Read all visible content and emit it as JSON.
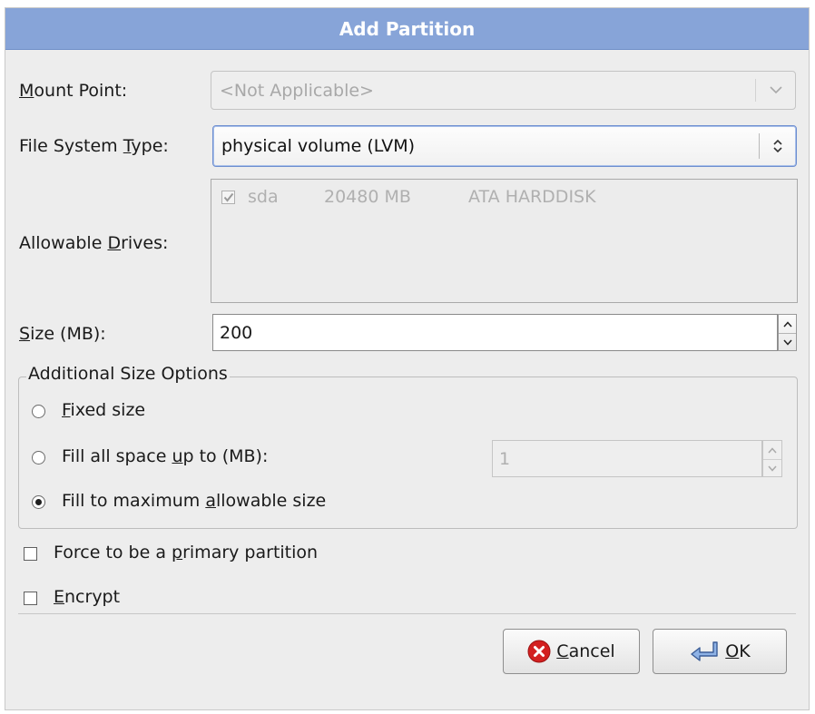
{
  "dialog": {
    "title": "Add Partition"
  },
  "mount_point": {
    "label_prefix": "",
    "label_mnemonic": "M",
    "label_rest": "ount Point:",
    "value": "<Not Applicable>"
  },
  "fs_type": {
    "label_prefix": "File System ",
    "label_mnemonic": "T",
    "label_rest": "ype:",
    "value": "physical volume (LVM)"
  },
  "drives": {
    "label_prefix": "Allowable ",
    "label_mnemonic": "D",
    "label_rest": "rives:",
    "items": [
      {
        "checked": true,
        "name": "sda",
        "size": "20480 MB",
        "model": "ATA HARDDISK"
      }
    ]
  },
  "size": {
    "label_prefix": "",
    "label_mnemonic": "S",
    "label_rest": "ize (MB):",
    "value": "200"
  },
  "size_options": {
    "title": "Additional Size Options",
    "fixed": {
      "prefix": "",
      "mnemonic": "F",
      "rest": "ixed size",
      "selected": false
    },
    "fill_up_to": {
      "prefix": "Fill all space ",
      "mnemonic": "u",
      "rest": "p to (MB):",
      "selected": false,
      "value": "1"
    },
    "fill_max": {
      "prefix": "Fill to maximum ",
      "mnemonic": "a",
      "rest": "llowable size",
      "selected": true
    }
  },
  "force_primary": {
    "prefix": "Force to be a ",
    "mnemonic": "p",
    "rest": "rimary partition",
    "checked": false
  },
  "encrypt": {
    "prefix": "",
    "mnemonic": "E",
    "rest": "ncrypt",
    "checked": false
  },
  "buttons": {
    "cancel": {
      "mnemonic": "C",
      "rest": "ancel",
      "icon": "cancel-icon"
    },
    "ok": {
      "mnemonic": "O",
      "rest": "K",
      "icon": "ok-enter-icon"
    }
  },
  "colors": {
    "titlebar": "#87a4d8",
    "cancel_icon": "#d32020"
  }
}
